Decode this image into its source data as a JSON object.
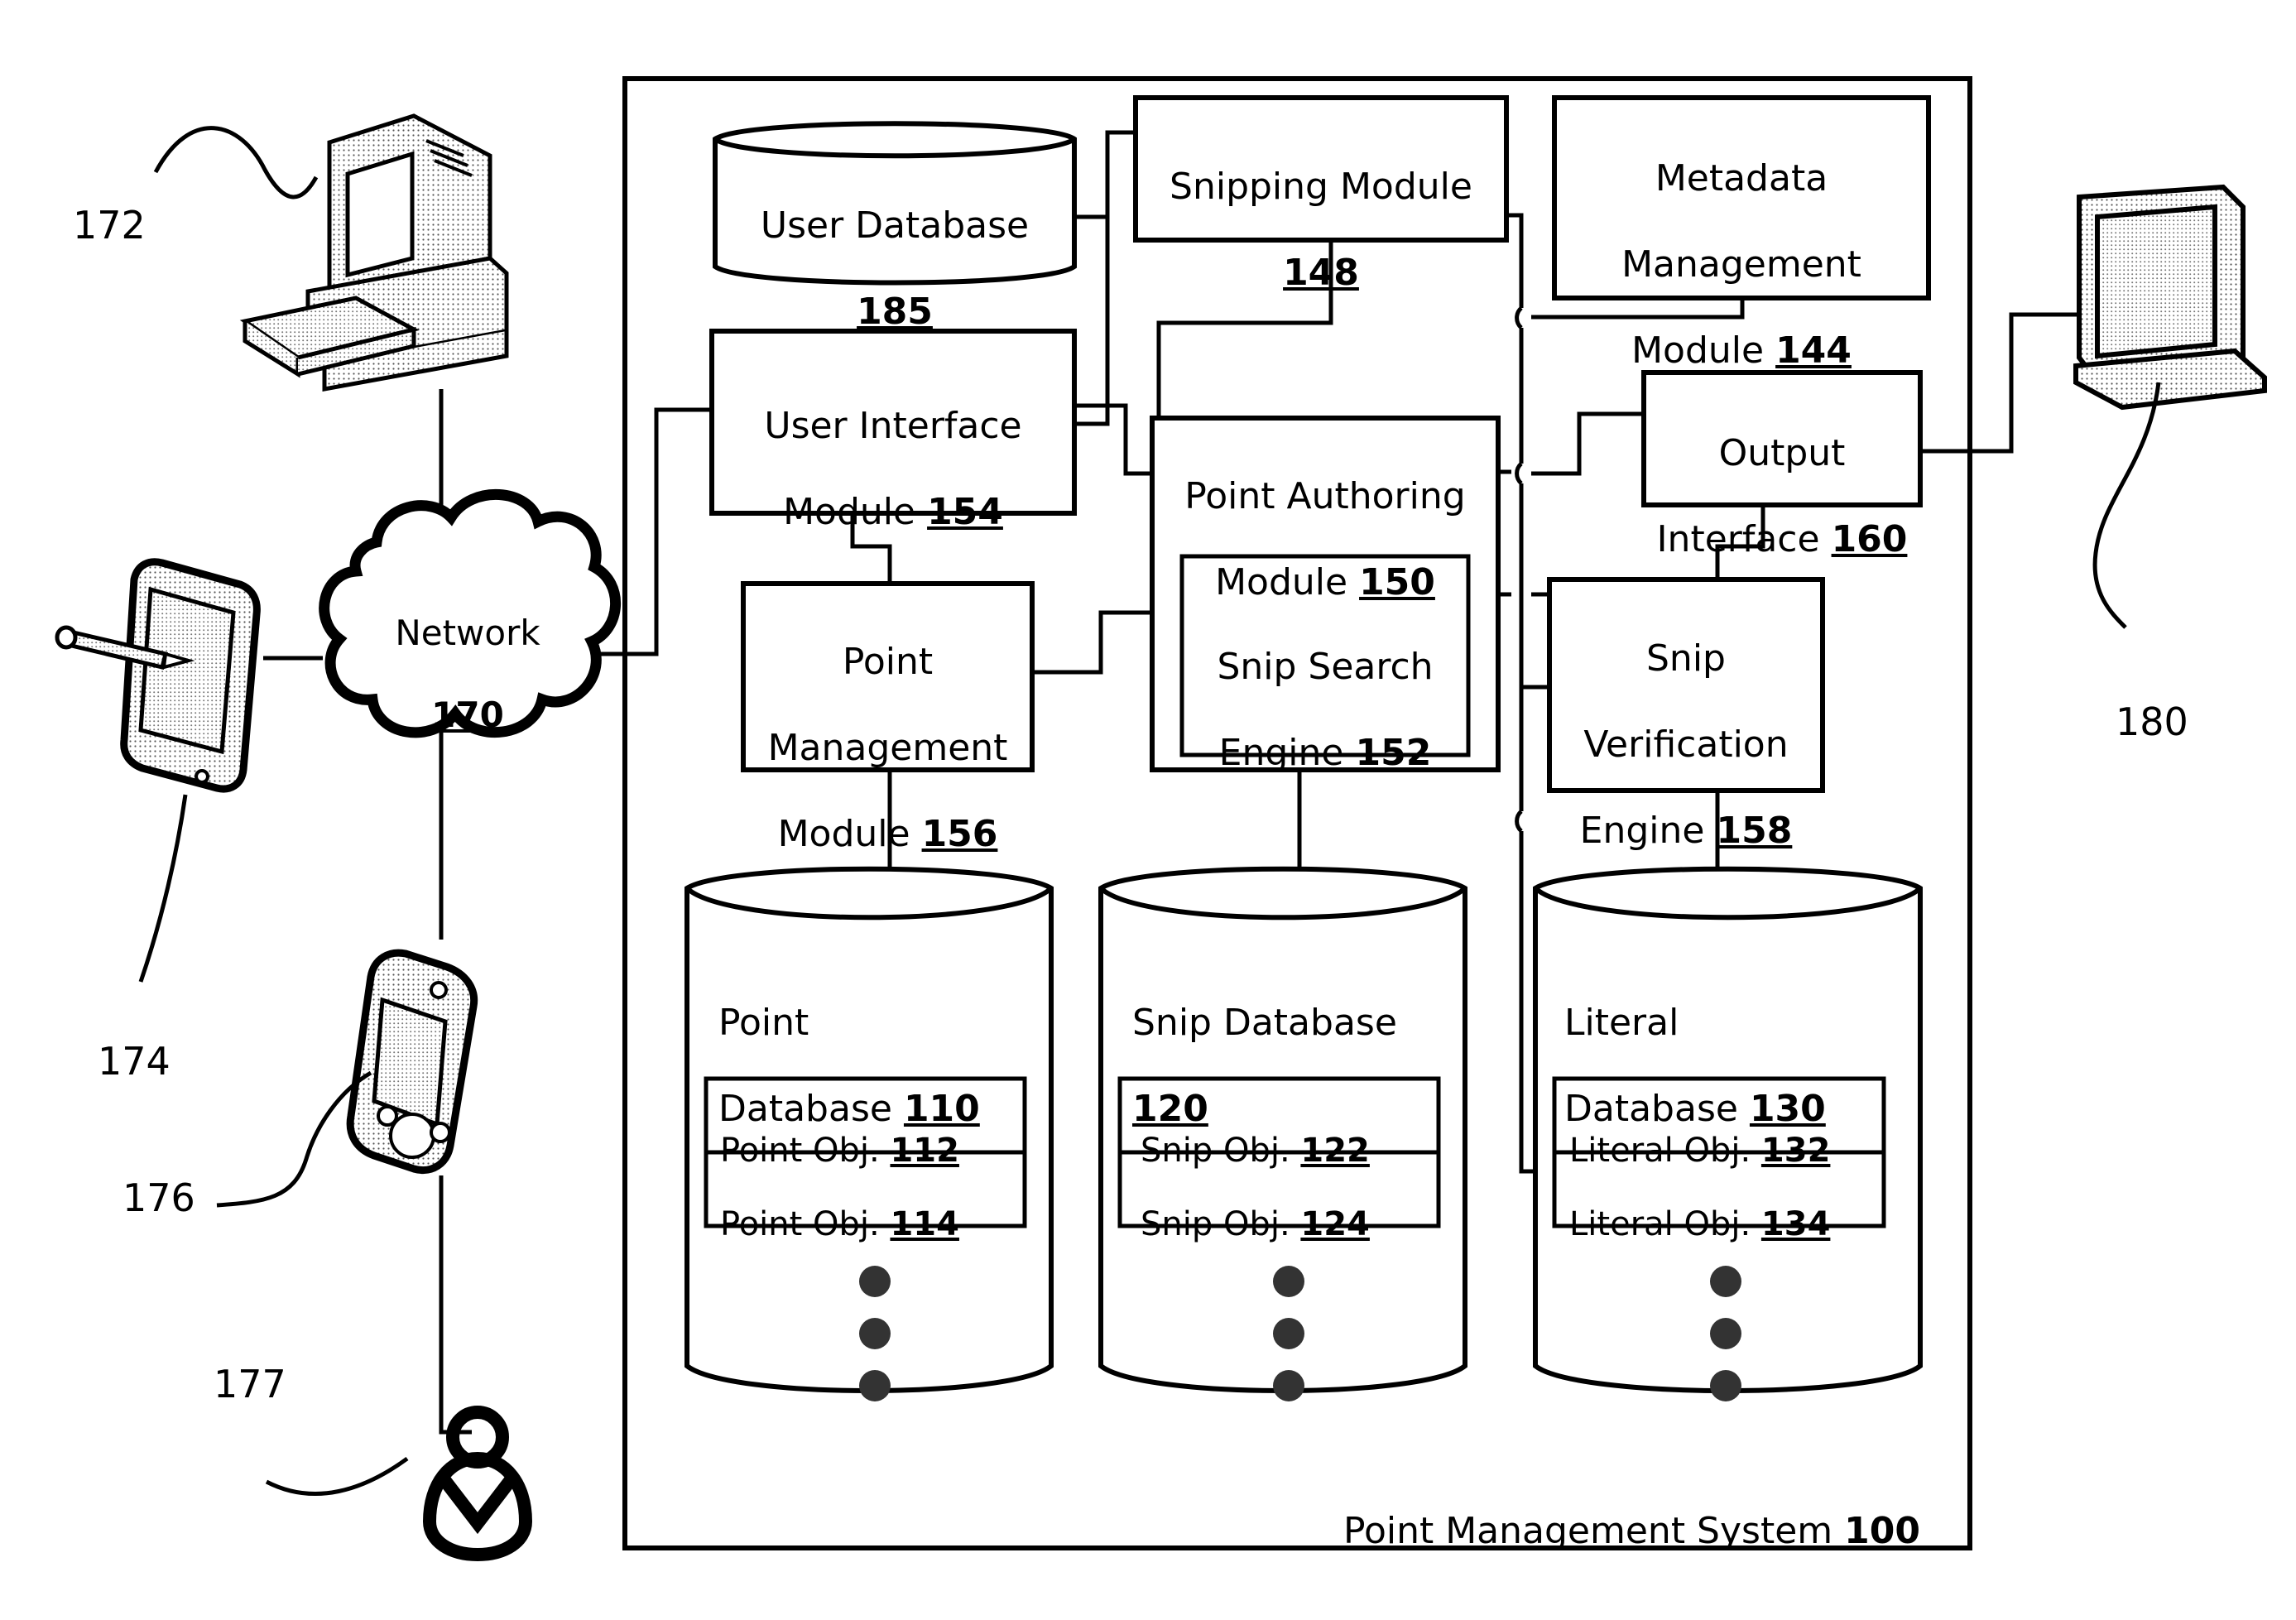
{
  "figure": {
    "system_label": "Point Management System",
    "system_ref": "100"
  },
  "network": {
    "label": "Network",
    "ref": "170"
  },
  "external_devices": [
    {
      "name": "desktop-computer",
      "ref": "172"
    },
    {
      "name": "tablet-with-stylus",
      "ref": "174"
    },
    {
      "name": "handheld-mobile-device",
      "ref": "176"
    },
    {
      "name": "user-person",
      "ref": "177"
    },
    {
      "name": "display-monitor",
      "ref": "180"
    }
  ],
  "modules": {
    "user_database": {
      "line1": "User Database",
      "line2": "",
      "ref": "185"
    },
    "snipping": {
      "line1": "Snipping Module",
      "line2": "",
      "ref": "148"
    },
    "metadata_mgmt": {
      "line1": "Metadata",
      "line2": "Management",
      "line3": "Module ",
      "ref": "144"
    },
    "user_interface": {
      "line1": "User Interface",
      "line2": "Module ",
      "ref": "154"
    },
    "point_authoring": {
      "line1": "Point Authoring",
      "line2": "Module ",
      "ref": "150"
    },
    "snip_search": {
      "line1": "Snip Search",
      "line2": "Engine ",
      "ref": "152"
    },
    "output_interface": {
      "line1": "Output",
      "line2": "Interface ",
      "ref": "160"
    },
    "snip_verification": {
      "line1": "Snip",
      "line2": "Verification",
      "line3": "Engine ",
      "ref": "158"
    },
    "point_management": {
      "line1": "Point",
      "line2": "Management",
      "line3": "Module ",
      "ref": "156"
    }
  },
  "databases": [
    {
      "key": "point_database",
      "title_line1": "Point",
      "title_line2": "Database ",
      "ref": "110",
      "objects": [
        {
          "label": "Point Obj. ",
          "ref": "112"
        },
        {
          "label": "Point Obj. ",
          "ref": "114"
        }
      ],
      "ellipsis": "•••"
    },
    {
      "key": "snip_database",
      "title_line1": "Snip Database",
      "title_line2": "",
      "ref": "120",
      "objects": [
        {
          "label": "Snip Obj. ",
          "ref": "122"
        },
        {
          "label": "Snip Obj. ",
          "ref": "124"
        }
      ],
      "ellipsis": "•••"
    },
    {
      "key": "literal_database",
      "title_line1": "Literal",
      "title_line2": "Database ",
      "ref": "130",
      "objects": [
        {
          "label": "Literal Obj. ",
          "ref": "132"
        },
        {
          "label": "Literal Obj. ",
          "ref": "134"
        }
      ],
      "ellipsis": "•••"
    }
  ],
  "colors": {
    "stroke": "#000000",
    "background": "#ffffff",
    "device_fill": "#d9d9d9",
    "screen_fill": "#c7c7c7"
  }
}
